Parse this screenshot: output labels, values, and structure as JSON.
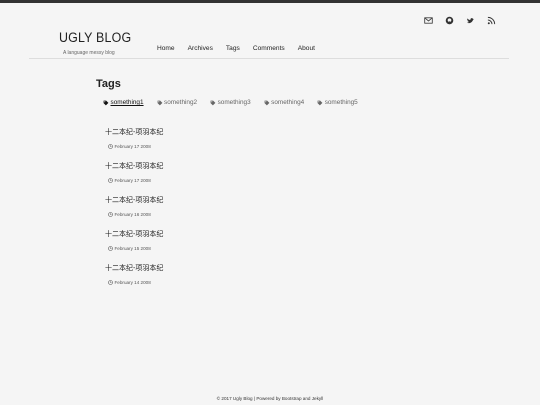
{
  "header": {
    "brand": "UGLY BLOG",
    "tagline": "A language messy blog",
    "social": [
      {
        "icon": "envelope-icon"
      },
      {
        "icon": "github-icon"
      },
      {
        "icon": "twitter-icon"
      },
      {
        "icon": "rss-icon"
      }
    ]
  },
  "nav": {
    "items": [
      "Home",
      "Archives",
      "Tags",
      "Comments",
      "About"
    ]
  },
  "main": {
    "title": "Tags",
    "tags": [
      {
        "label": "something1",
        "active": true
      },
      {
        "label": "something2",
        "active": false
      },
      {
        "label": "something3",
        "active": false
      },
      {
        "label": "something4",
        "active": false
      },
      {
        "label": "something5",
        "active": false
      }
    ],
    "posts": [
      {
        "title": "十二本纪-项羽本纪",
        "date": "February 17 2008"
      },
      {
        "title": "十二本纪-项羽本纪",
        "date": "February 17 2008"
      },
      {
        "title": "十二本纪-项羽本纪",
        "date": "February 16 2008"
      },
      {
        "title": "十二本纪-项羽本纪",
        "date": "February 15 2008"
      },
      {
        "title": "十二本纪-项羽本纪",
        "date": "February 14 2008"
      }
    ]
  },
  "footer": {
    "text": "© 2017 Ugly Blog | Powered by Bootstrap and Jekyll"
  }
}
